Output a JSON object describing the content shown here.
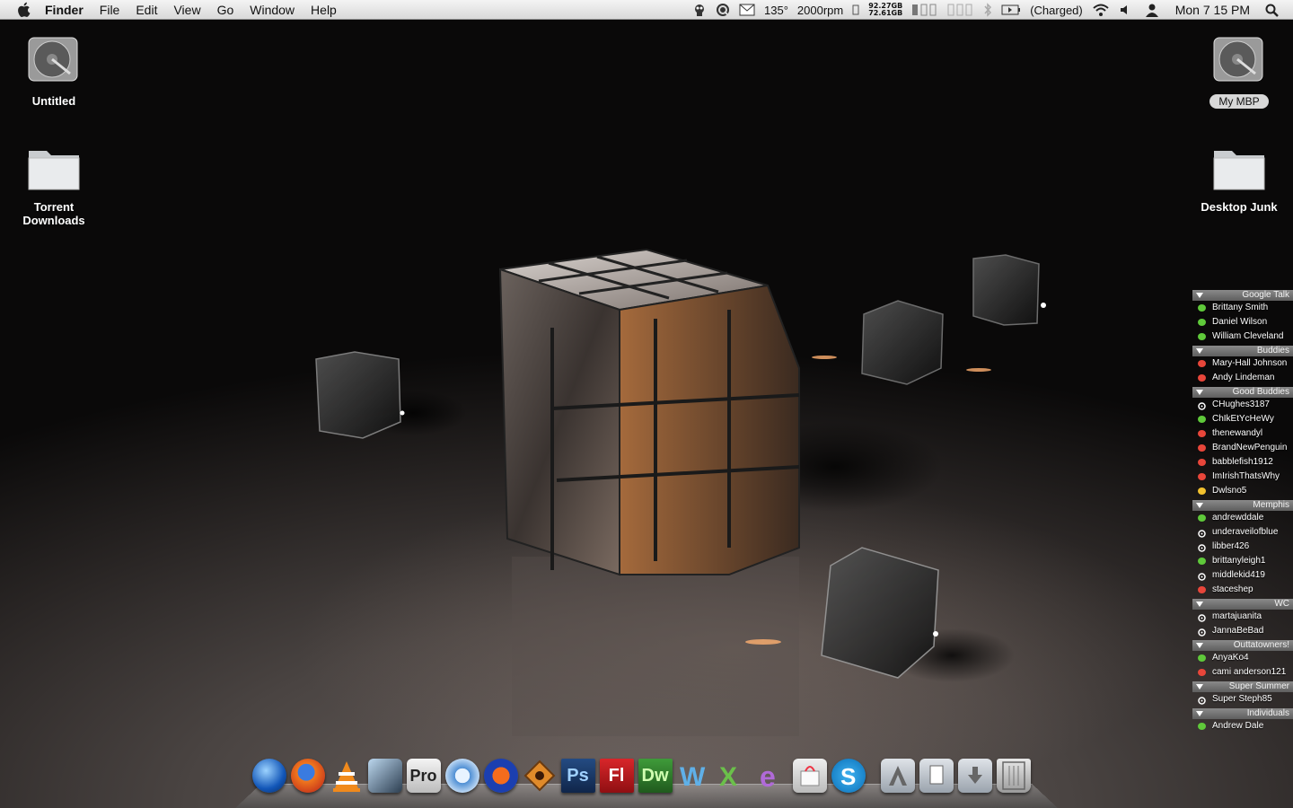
{
  "menubar": {
    "app": "Finder",
    "menus": [
      "File",
      "Edit",
      "View",
      "Go",
      "Window",
      "Help"
    ],
    "status": {
      "temp": "135°",
      "fan": "2000rpm",
      "disk_top": "92.27GB",
      "disk_bottom": "72.61GB",
      "battery": "(Charged)",
      "clock": "Mon 7 15 PM"
    }
  },
  "desktop": {
    "icons_left": [
      {
        "label": "Untitled"
      },
      {
        "label": "Torrent Downloads"
      }
    ],
    "icons_right": [
      {
        "label": "My MBP"
      },
      {
        "label": "Desktop Junk"
      }
    ]
  },
  "buddy_list": {
    "groups": [
      {
        "name": "Google Talk",
        "buddies": [
          {
            "name": "Brittany Smith",
            "status": "available"
          },
          {
            "name": "Daniel Wilson",
            "status": "available"
          },
          {
            "name": "William Cleveland",
            "status": "available"
          }
        ]
      },
      {
        "name": "Buddies",
        "buddies": [
          {
            "name": "Mary-Hall Johnson",
            "status": "busy"
          },
          {
            "name": "Andy Lindeman",
            "status": "busy"
          }
        ]
      },
      {
        "name": "Good Buddies",
        "buddies": [
          {
            "name": "CHughes3187",
            "status": "idle"
          },
          {
            "name": "ChIkEtYcHeWy",
            "status": "available"
          },
          {
            "name": "thenewandyl",
            "status": "busy"
          },
          {
            "name": "BrandNewPenguin",
            "status": "busy"
          },
          {
            "name": "babblefish1912",
            "status": "busy"
          },
          {
            "name": "ImIrishThatsWhy",
            "status": "busy"
          },
          {
            "name": "Dwlsno5",
            "status": "away"
          }
        ]
      },
      {
        "name": "Memphis",
        "buddies": [
          {
            "name": "andrewddale",
            "status": "available"
          },
          {
            "name": "underaveilofblue",
            "status": "idle"
          },
          {
            "name": "libber426",
            "status": "idle"
          },
          {
            "name": "brittanyleigh1",
            "status": "available"
          },
          {
            "name": "middlekid419",
            "status": "idle"
          },
          {
            "name": "staceshep",
            "status": "busy"
          }
        ]
      },
      {
        "name": "WC",
        "buddies": [
          {
            "name": "martajuanita",
            "status": "idle"
          },
          {
            "name": "JannaBeBad",
            "status": "idle"
          }
        ]
      },
      {
        "name": "Outtatowners!",
        "buddies": [
          {
            "name": "AnyaKo4",
            "status": "available"
          },
          {
            "name": "cami anderson121",
            "status": "busy"
          }
        ]
      },
      {
        "name": "Super Summer",
        "buddies": [
          {
            "name": "Super Steph85",
            "status": "idle"
          }
        ]
      },
      {
        "name": "Individuals",
        "buddies": [
          {
            "name": "Andrew Dale",
            "status": "available"
          }
        ]
      }
    ],
    "status_colors": {
      "available": "#5fc93a",
      "busy": "#e8463a",
      "away": "#f2c12e",
      "idle": "#ffffff"
    }
  },
  "dock": {
    "items": [
      {
        "name": "quicksilver-icon",
        "text": ""
      },
      {
        "name": "firefox-icon",
        "text": ""
      },
      {
        "name": "vlc-icon",
        "text": ""
      },
      {
        "name": "cd-ripper-icon",
        "text": ""
      },
      {
        "name": "pro-icon",
        "text": "Pro"
      },
      {
        "name": "itunes-icon",
        "text": ""
      },
      {
        "name": "audacity-icon",
        "text": ""
      },
      {
        "name": "reason-icon",
        "text": ""
      },
      {
        "name": "photoshop-icon",
        "text": "Ps"
      },
      {
        "name": "flash-icon",
        "text": "Fl"
      },
      {
        "name": "dreamweaver-icon",
        "text": "Dw"
      },
      {
        "name": "word-icon",
        "text": ""
      },
      {
        "name": "excel-icon",
        "text": ""
      },
      {
        "name": "entourage-icon",
        "text": ""
      },
      {
        "name": "app-store-bag-icon",
        "text": ""
      },
      {
        "name": "skype-icon",
        "text": ""
      },
      {
        "name": "applications-stack-icon",
        "text": ""
      },
      {
        "name": "documents-stack-icon",
        "text": ""
      },
      {
        "name": "downloads-stack-icon",
        "text": ""
      },
      {
        "name": "trash-icon",
        "text": ""
      }
    ]
  }
}
